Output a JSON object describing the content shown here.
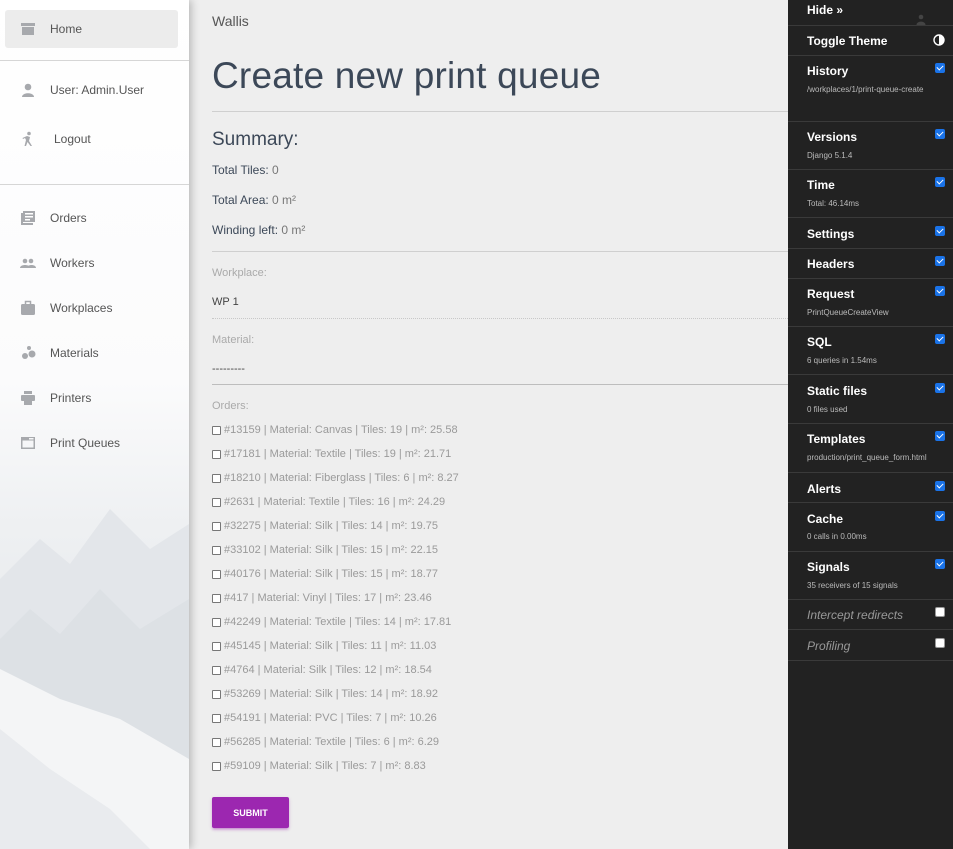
{
  "sidebar": {
    "home": "Home",
    "user": "User: Admin.User",
    "logout": "Logout",
    "nav": [
      {
        "label": "Orders",
        "icon": "orders-icon"
      },
      {
        "label": "Workers",
        "icon": "workers-icon"
      },
      {
        "label": "Workplaces",
        "icon": "briefcase-icon"
      },
      {
        "label": "Materials",
        "icon": "bubbles-icon"
      },
      {
        "label": "Printers",
        "icon": "printer-icon"
      },
      {
        "label": "Print Queues",
        "icon": "queue-icon"
      }
    ]
  },
  "main": {
    "brand": "Wallis",
    "title": "Create new print queue",
    "summary_title": "Summary:",
    "summary": [
      {
        "label": "Total Tiles:",
        "value": "0"
      },
      {
        "label": "Total Area:",
        "value": "0 m²"
      },
      {
        "label": "Winding left:",
        "value": "0 m²"
      }
    ],
    "workplace_label": "Workplace:",
    "workplace_value": "WP 1",
    "material_label": "Material:",
    "material_value": "---------",
    "orders_label": "Orders:",
    "orders": [
      "#13159 | Material: Canvas | Tiles: 19 | m²: 25.58",
      "#17181 | Material: Textile | Tiles: 19 | m²: 21.71",
      "#18210 | Material: Fiberglass | Tiles: 6 | m²: 8.27",
      "#2631 | Material: Textile | Tiles: 16 | m²: 24.29",
      "#32275 | Material: Silk | Tiles: 14 | m²: 19.75",
      "#33102 | Material: Silk | Tiles: 15 | m²: 22.15",
      "#40176 | Material: Silk | Tiles: 15 | m²: 18.77",
      "#417 | Material: Vinyl | Tiles: 17 | m²: 23.46",
      "#42249 | Material: Textile | Tiles: 14 | m²: 17.81",
      "#45145 | Material: Silk | Tiles: 11 | m²: 11.03",
      "#4764 | Material: Silk | Tiles: 12 | m²: 18.54",
      "#53269 | Material: Silk | Tiles: 14 | m²: 18.92",
      "#54191 | Material: PVC | Tiles: 7 | m²: 10.26",
      "#56285 | Material: Textile | Tiles: 6 | m²: 6.29",
      "#59109 | Material: Silk | Tiles: 7 | m²: 8.83"
    ],
    "submit": "SUBMIT"
  },
  "debug_toolbar": {
    "hide": "Hide »",
    "toggle_theme": "Toggle Theme",
    "panels": [
      {
        "title": "History",
        "sub": "/workplaces/1/print-queue-create",
        "checked": true
      },
      {
        "title": "Versions",
        "sub": "Django 5.1.4",
        "checked": true
      },
      {
        "title": "Time",
        "sub": "Total: 46.14ms",
        "checked": true
      },
      {
        "title": "Settings",
        "sub": "",
        "checked": true
      },
      {
        "title": "Headers",
        "sub": "",
        "checked": true
      },
      {
        "title": "Request",
        "sub": "PrintQueueCreateView",
        "checked": true
      },
      {
        "title": "SQL",
        "sub": "6 queries in 1.54ms",
        "checked": true
      },
      {
        "title": "Static files",
        "sub": "0 files used",
        "checked": true
      },
      {
        "title": "Templates",
        "sub": "production/print_queue_form.html",
        "checked": true
      },
      {
        "title": "Alerts",
        "sub": "",
        "checked": true
      },
      {
        "title": "Cache",
        "sub": "0 calls in 0.00ms",
        "checked": true
      },
      {
        "title": "Signals",
        "sub": "35 receivers of 15 signals",
        "checked": true
      },
      {
        "title": "Intercept redirects",
        "sub": "",
        "checked": false
      },
      {
        "title": "Profiling",
        "sub": "",
        "checked": false
      }
    ]
  },
  "colors": {
    "accent": "#9c27b0",
    "toolbar_bg": "#222222",
    "checkbox": "#1a73e8"
  }
}
